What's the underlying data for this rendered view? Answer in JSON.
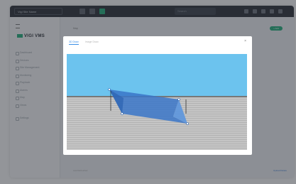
{
  "topbar": {
    "site_select": "Vigi Site Name",
    "search_placeholder": "Search",
    "icons": [
      "grid-icon",
      "settings-icon",
      "map-icon",
      "bell-icon",
      "user-icon"
    ]
  },
  "sidebar": {
    "logo": "VIGI VMS",
    "items": [
      {
        "label": "Dashboard"
      },
      {
        "label": "Devices"
      },
      {
        "label": "Site Management"
      },
      {
        "label": "Monitoring"
      },
      {
        "label": "Playback"
      },
      {
        "label": "Alarms"
      },
      {
        "label": "Map"
      },
      {
        "label": "Views"
      },
      {
        "label": "Settings"
      }
    ]
  },
  "content": {
    "tab_label": "Map",
    "add_label": "+ Add",
    "footer_left": "Last Refreshed",
    "footer_right": "Upload   Delete"
  },
  "modal": {
    "tabs": [
      "3D Draw",
      "Image Draw"
    ],
    "close_symbol": "×",
    "colors": {
      "sky": "#6cc3ee",
      "ground": "#bdbdbd",
      "polygon": "#3a76c8",
      "polygon_light": "#5b95dd"
    }
  }
}
